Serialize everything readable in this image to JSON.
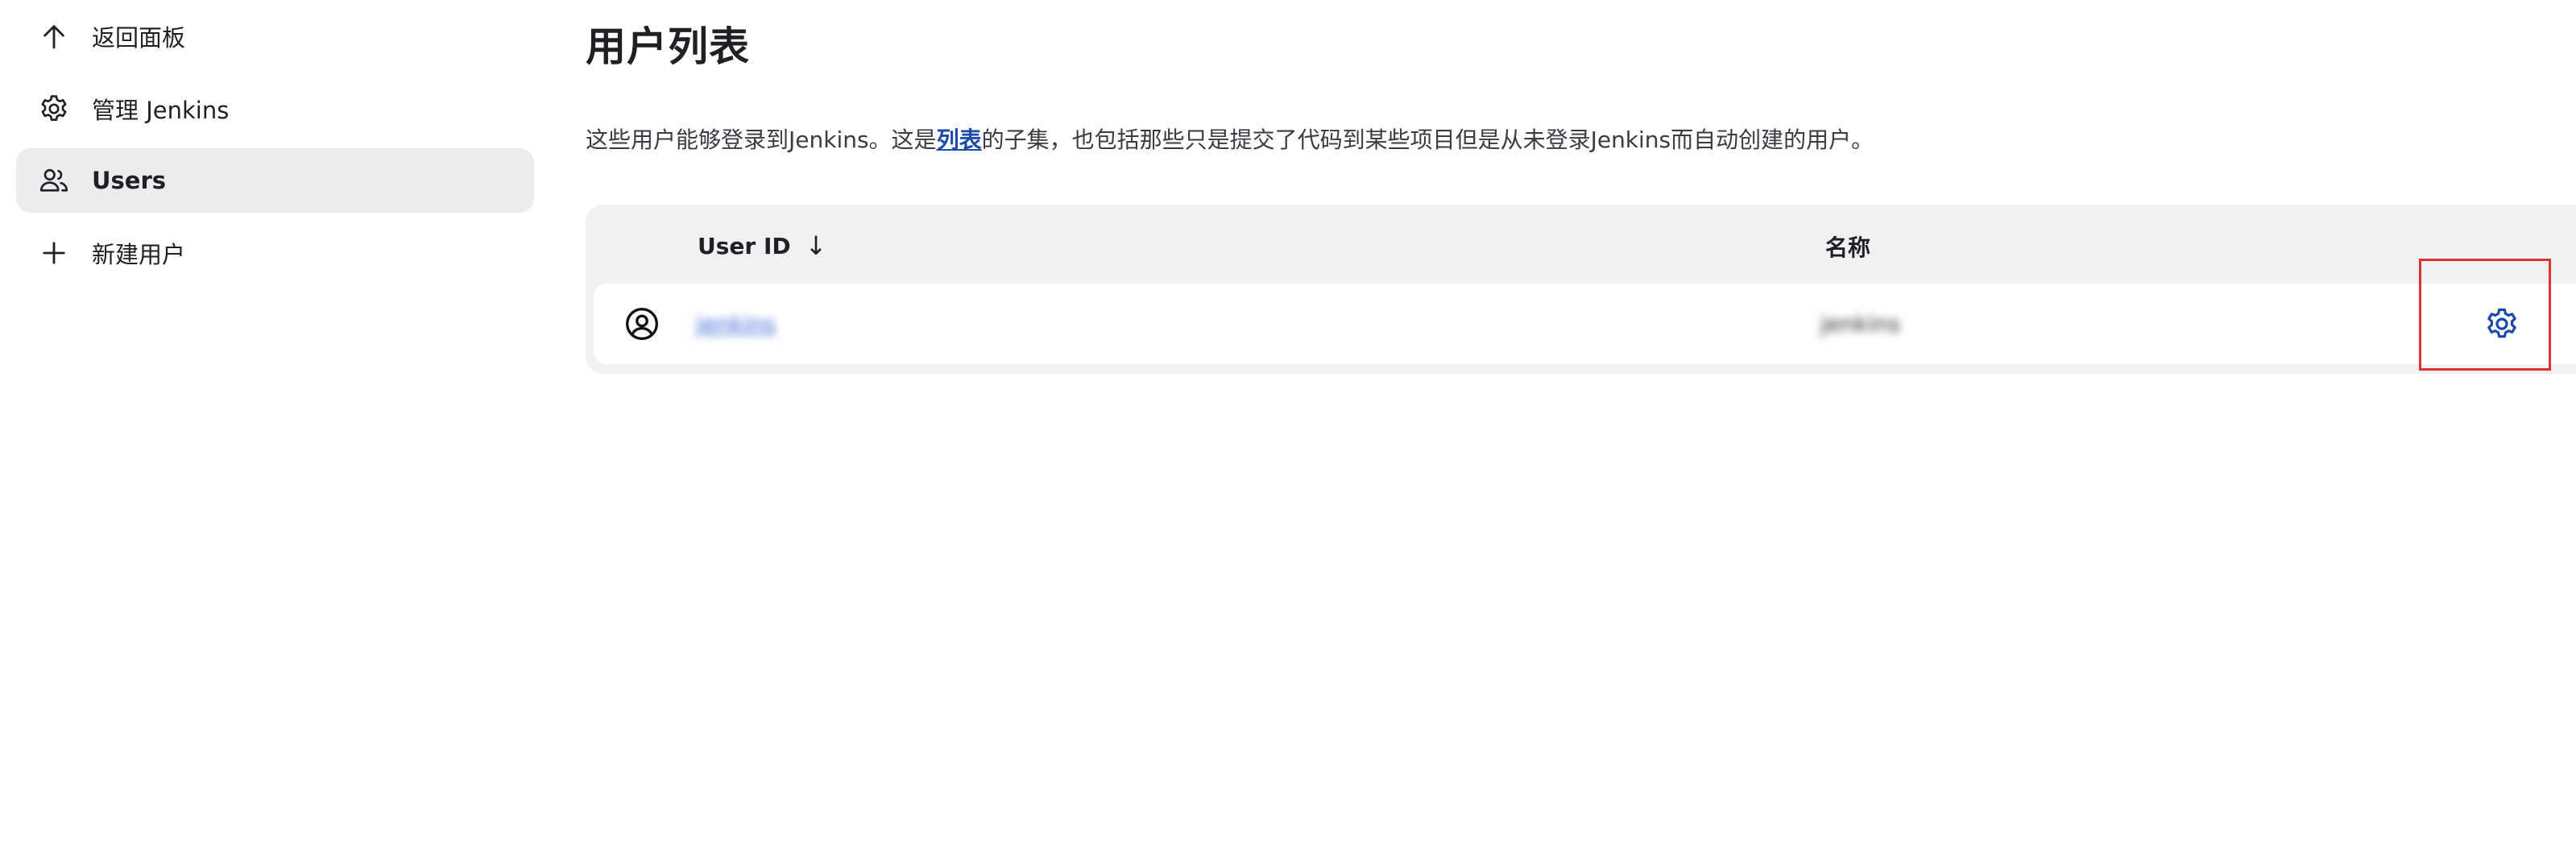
{
  "sidebar": {
    "items": [
      {
        "label": "返回面板",
        "icon": "arrow-up-icon"
      },
      {
        "label": "管理 Jenkins",
        "icon": "gear-icon"
      },
      {
        "label": "Users",
        "icon": "users-icon",
        "active": true
      },
      {
        "label": "新建用户",
        "icon": "plus-icon"
      }
    ]
  },
  "main": {
    "title": "用户列表",
    "description": {
      "before": "这些用户能够登录到Jenkins。这是",
      "link": "列表",
      "after": "的子集，也包括那些只是提交了代码到某些项目但是从未登录Jenkins而自动创建的用户。"
    },
    "table": {
      "headers": {
        "user_id": "User ID",
        "sort_indicator": "↓",
        "name": "名称"
      },
      "rows": [
        {
          "user_id": "jenkins",
          "name": "jenkins"
        }
      ]
    }
  },
  "colors": {
    "accent": "#1c4aa8",
    "highlight": "#e0322f",
    "sidebar_active": "#ececee",
    "table_bg": "#f1f1f3"
  }
}
